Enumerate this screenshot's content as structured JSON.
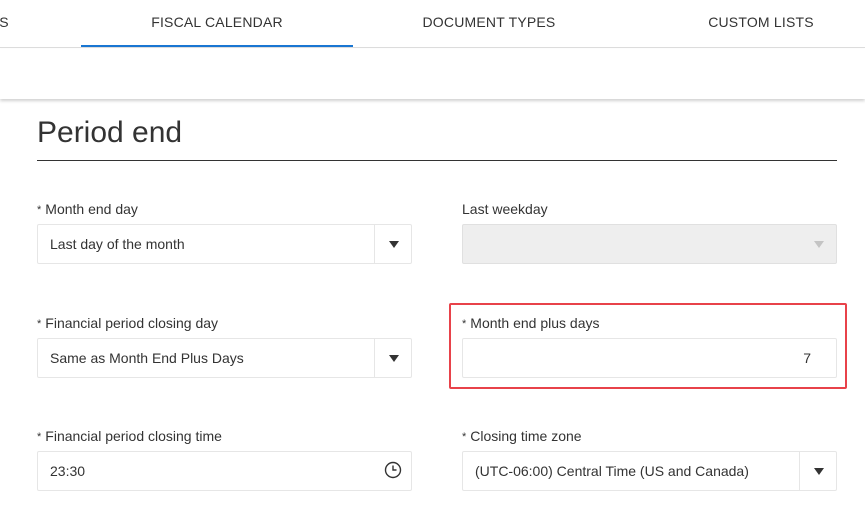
{
  "tabs": [
    {
      "label": "S"
    },
    {
      "label": "FISCAL CALENDAR",
      "active": true
    },
    {
      "label": "DOCUMENT TYPES"
    },
    {
      "label": "CUSTOM LISTS"
    }
  ],
  "accent_color": "#1976d2",
  "highlight_color": "#e8424a",
  "section": {
    "title": "Period end"
  },
  "required_marker": "*",
  "fields": {
    "month_end_day": {
      "label": "Month end day",
      "value": "Last day of the month",
      "required": true,
      "icon": "chevron-down-icon"
    },
    "last_weekday": {
      "label": "Last weekday",
      "value": "",
      "disabled": true,
      "icon": "chevron-down-icon"
    },
    "financial_period_closing_day": {
      "label": "Financial period closing day",
      "value": "Same as Month End Plus Days",
      "required": true,
      "icon": "chevron-down-icon"
    },
    "month_end_plus_days": {
      "label": "Month end plus days",
      "value": "7",
      "required": true,
      "highlighted": true
    },
    "financial_period_closing_time": {
      "label": "Financial period closing time",
      "value": "23:30",
      "required": true,
      "icon": "clock-icon"
    },
    "closing_time_zone": {
      "label": "Closing time zone",
      "value": "(UTC-06:00) Central Time (US and Canada)",
      "required": true,
      "icon": "chevron-down-icon"
    }
  }
}
